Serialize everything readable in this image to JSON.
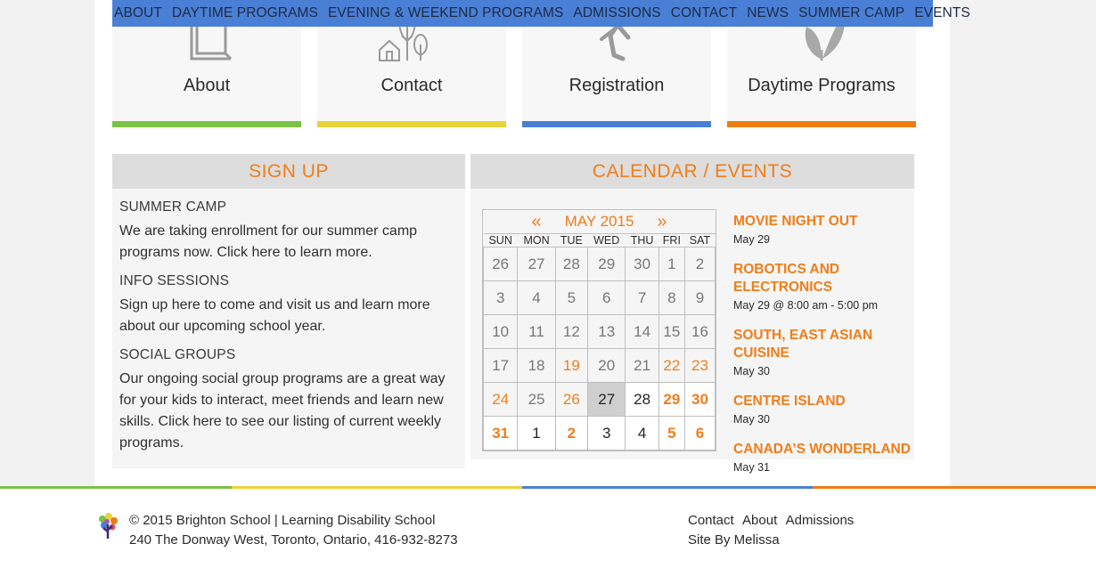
{
  "nav": {
    "items": [
      "ABOUT",
      "DAYTIME PROGRAMS",
      "EVENING & WEEKEND PROGRAMS",
      "ADMISSIONS",
      "CONTACT",
      "NEWS",
      "SUMMER CAMP",
      "EVENTS"
    ],
    "color": "#4a7fd6"
  },
  "tiles": [
    {
      "label": "About",
      "icon": "book-icon",
      "color": "#7cc142"
    },
    {
      "label": "Contact",
      "icon": "house-tree-icon",
      "color": "#e8d33a"
    },
    {
      "label": "Registration",
      "icon": "gymnast-icon",
      "color": "#4a7fd6"
    },
    {
      "label": "Daytime Programs",
      "icon": "leaf-icon",
      "color": "#ef7d12"
    }
  ],
  "signup": {
    "title": "SIGN UP",
    "sections": [
      {
        "heading": "SUMMER CAMP",
        "text": "We are taking enrollment for our summer camp programs now. Click here to learn more."
      },
      {
        "heading": "INFO SESSIONS",
        "text": "Sign up here to come and visit us and learn more about our upcoming school year."
      },
      {
        "heading": "SOCIAL GROUPS",
        "text": "Our ongoing social group programs are a great way for your kids to interact, meet friends and learn new skills. Click here to see our listing of current weekly programs."
      }
    ]
  },
  "calendar": {
    "title": "CALENDAR / EVENTS",
    "prev": "«",
    "next": "»",
    "month": "MAY 2015",
    "weekdays": [
      "SUN",
      "MON",
      "TUE",
      "WED",
      "THU",
      "FRI",
      "SAT"
    ],
    "weeks": [
      [
        {
          "d": "26",
          "t": "other"
        },
        {
          "d": "27",
          "t": "other"
        },
        {
          "d": "28",
          "t": "other"
        },
        {
          "d": "29",
          "t": "other"
        },
        {
          "d": "30",
          "t": "other"
        },
        {
          "d": "1",
          "t": "other"
        },
        {
          "d": "2",
          "t": "other"
        }
      ],
      [
        {
          "d": "3",
          "t": "other"
        },
        {
          "d": "4",
          "t": "other"
        },
        {
          "d": "5",
          "t": "other"
        },
        {
          "d": "6",
          "t": "other"
        },
        {
          "d": "7",
          "t": "other"
        },
        {
          "d": "8",
          "t": "other"
        },
        {
          "d": "9",
          "t": "other"
        }
      ],
      [
        {
          "d": "10",
          "t": "other"
        },
        {
          "d": "11",
          "t": "other"
        },
        {
          "d": "12",
          "t": "other"
        },
        {
          "d": "13",
          "t": "other"
        },
        {
          "d": "14",
          "t": "other"
        },
        {
          "d": "15",
          "t": "other"
        },
        {
          "d": "16",
          "t": "other"
        }
      ],
      [
        {
          "d": "17",
          "t": "other"
        },
        {
          "d": "18",
          "t": "other"
        },
        {
          "d": "19",
          "t": "ev"
        },
        {
          "d": "20",
          "t": "other"
        },
        {
          "d": "21",
          "t": "other"
        },
        {
          "d": "22",
          "t": "ev"
        },
        {
          "d": "23",
          "t": "ev"
        }
      ],
      [
        {
          "d": "24",
          "t": "ev"
        },
        {
          "d": "25",
          "t": "other"
        },
        {
          "d": "26",
          "t": "ev"
        },
        {
          "d": "27",
          "t": "today"
        },
        {
          "d": "28",
          "t": "cur"
        },
        {
          "d": "29",
          "t": "evb"
        },
        {
          "d": "30",
          "t": "evb"
        }
      ],
      [
        {
          "d": "31",
          "t": "evb"
        },
        {
          "d": "1",
          "t": "cur"
        },
        {
          "d": "2",
          "t": "evb"
        },
        {
          "d": "3",
          "t": "cur"
        },
        {
          "d": "4",
          "t": "cur"
        },
        {
          "d": "5",
          "t": "evb"
        },
        {
          "d": "6",
          "t": "evb"
        }
      ]
    ],
    "events": [
      {
        "title": "MOVIE NIGHT OUT",
        "date": "May 29"
      },
      {
        "title": "ROBOTICS AND ELECTRONICS",
        "date": "May 29 @ 8:00 am - 5:00 pm"
      },
      {
        "title": "SOUTH, EAST ASIAN CUISINE",
        "date": "May 30"
      },
      {
        "title": "CENTRE ISLAND",
        "date": "May 30"
      },
      {
        "title": "CANADA’S WONDERLAND",
        "date": "May 31"
      }
    ]
  },
  "footer": {
    "line1": "© 2015 Brighton School | Learning Disability School",
    "line2": "240 The Donway West, Toronto, Ontario,  416-932-8273",
    "links": [
      "Contact",
      "About",
      "Admissions"
    ],
    "credit": "Site By Melissa",
    "stripe_colors": [
      "#7cc142",
      "#e8d33a",
      "#4a7fd6",
      "#ef7d12"
    ]
  }
}
